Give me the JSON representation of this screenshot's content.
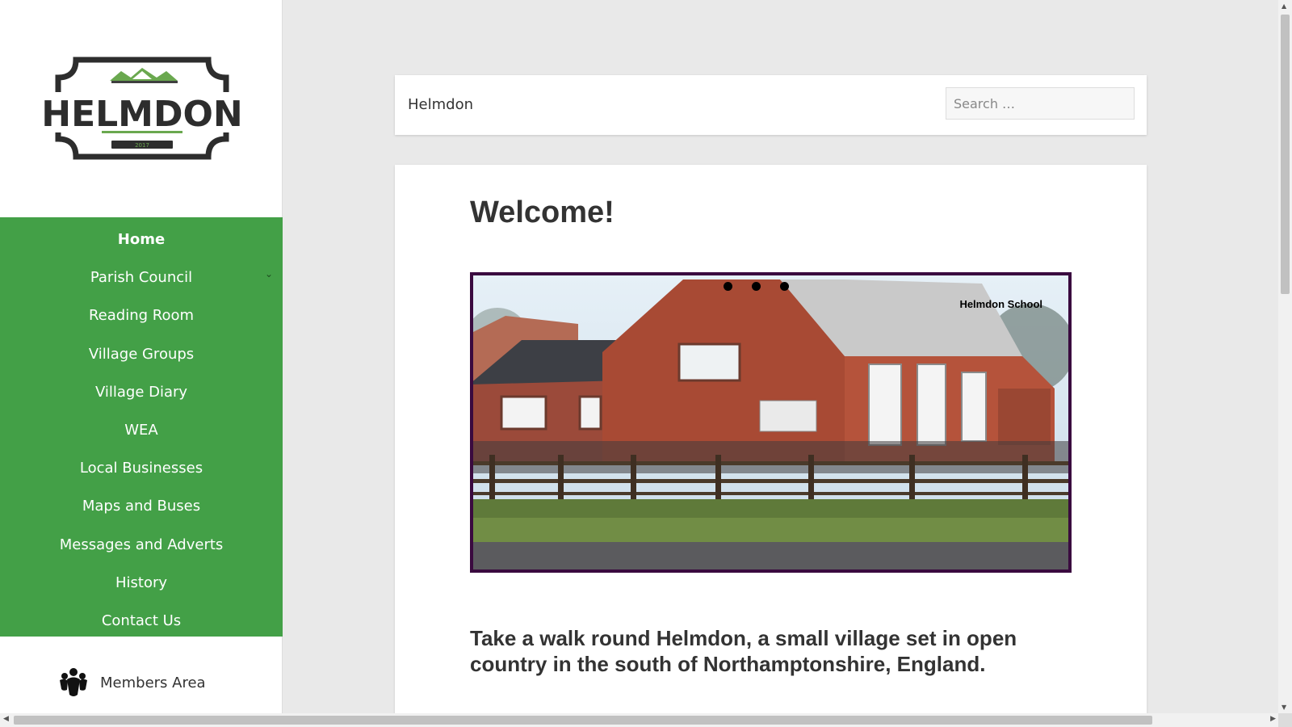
{
  "sidebar": {
    "logo_text": "HELMDON",
    "logo_year": "2017",
    "nav": [
      {
        "label": "Home",
        "active": true
      },
      {
        "label": "Parish Council",
        "has_submenu": true
      },
      {
        "label": "Reading Room"
      },
      {
        "label": "Village Groups"
      },
      {
        "label": "Village Diary"
      },
      {
        "label": "WEA"
      },
      {
        "label": "Local Businesses"
      },
      {
        "label": "Maps and Buses"
      },
      {
        "label": "Messages and Adverts"
      },
      {
        "label": "History"
      },
      {
        "label": "Contact Us"
      }
    ],
    "submenu_icon": "chevron-down-icon",
    "members_label": "Members Area",
    "members_icon": "users-icon",
    "nav_color": "#43a047"
  },
  "header": {
    "site_title": "Helmdon",
    "search_placeholder": "Search …"
  },
  "main": {
    "title": "Welcome!",
    "slider": {
      "caption": "Helmdon School",
      "dots": 3,
      "border_color": "#3a0a3f"
    },
    "intro": "Take a walk round Helmdon, a small village set in open country in the south of Northamptonshire, England."
  }
}
